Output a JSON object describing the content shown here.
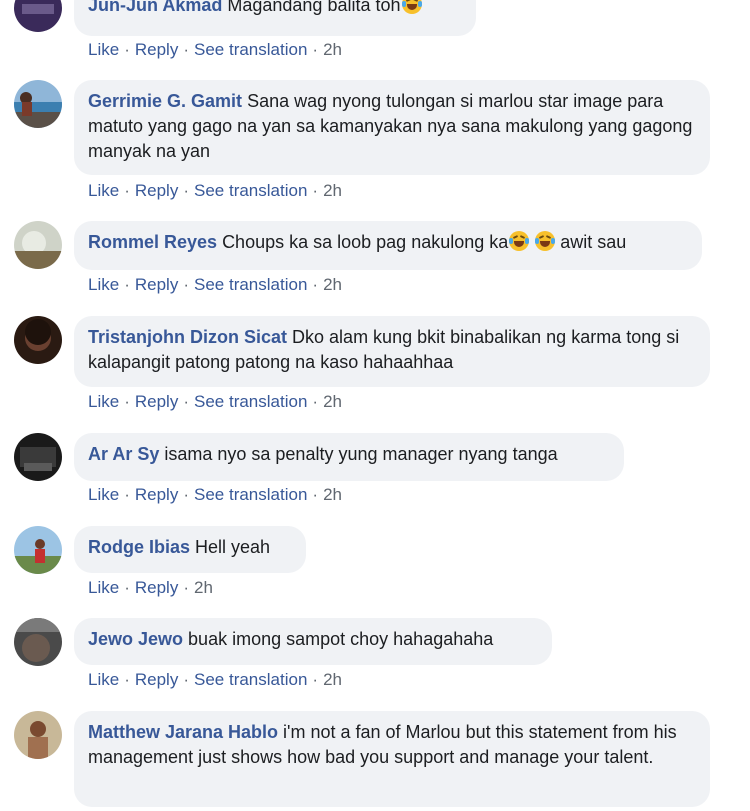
{
  "actions": {
    "like": "Like",
    "reply": "Reply",
    "see_translation": "See translation",
    "separator": "·"
  },
  "emoji_icon": "laughing-tears-emoji",
  "comments": [
    {
      "author": "Jun-Jun Akmad",
      "text": "Magandang balita toh",
      "time": "2h",
      "has_translation": true
    },
    {
      "author": "Gerrimie G. Gamit",
      "text": "Sana wag nyong tulongan si marlou star image para matuto yang gago na yan sa kamanyakan nya sana makulong yang gagong manyak na yan",
      "time": "2h",
      "has_translation": true
    },
    {
      "author": "Rommel Reyes",
      "text_before": "Choups ka sa loob pag nakulong ka",
      "text_after": " awit sau",
      "time": "2h",
      "has_translation": true
    },
    {
      "author": "Tristanjohn Dizon Sicat",
      "text": "Dko alam kung bkit binabalikan ng karma tong si kalapangit patong patong na kaso hahaahhaa",
      "time": "2h",
      "has_translation": true
    },
    {
      "author": "Ar Ar Sy",
      "text": "isama nyo sa penalty yung manager nyang tanga",
      "time": "2h",
      "has_translation": true
    },
    {
      "author": "Rodge Ibias",
      "text": "Hell yeah",
      "time": "2h",
      "has_translation": false
    },
    {
      "author": "Jewo Jewo",
      "text": "buak imong sampot choy hahagahaha",
      "time": "2h",
      "has_translation": true
    },
    {
      "author": "Matthew Jarana Hablo",
      "text": "i'm not a fan of Marlou but this statement from his management just shows how bad you support and manage your talent.",
      "time": "",
      "has_translation": false
    }
  ]
}
